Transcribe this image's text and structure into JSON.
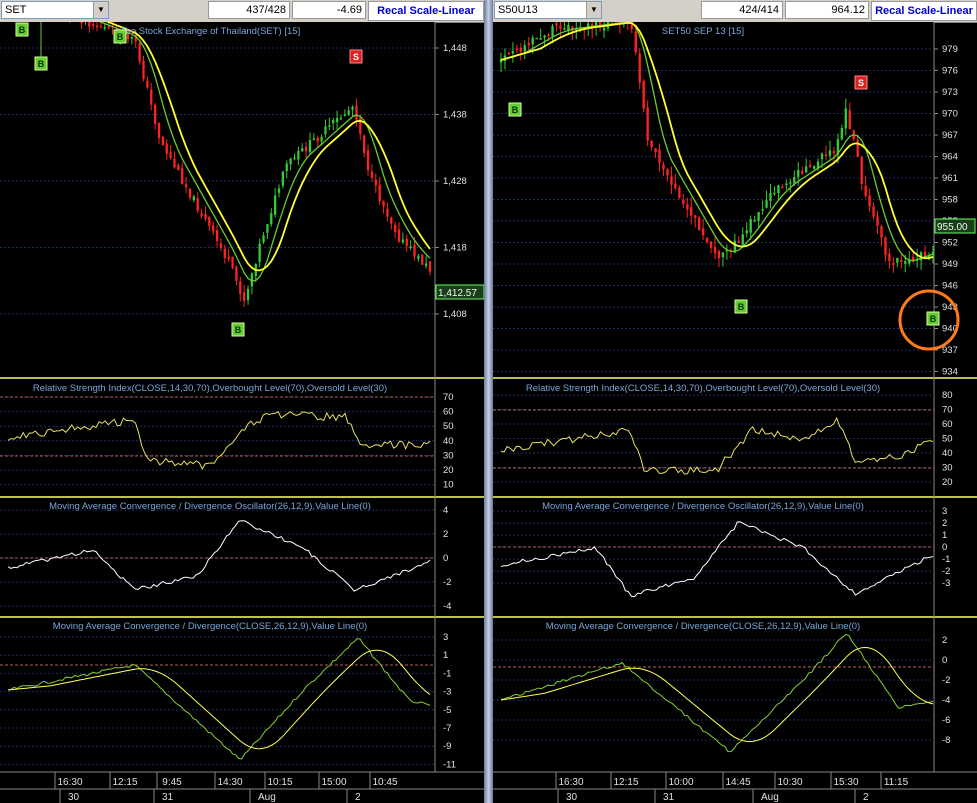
{
  "left": {
    "symbol": "SET",
    "volume": "437/428",
    "change": "-4.69",
    "recal": "Recal Scale-Linear",
    "main_title": "The Stock Exchange of Thailand(SET) [15]",
    "price_ticks": [
      "1,448",
      "1,438",
      "1,428",
      "1,418",
      "1,408"
    ],
    "last_price": "1,412.57",
    "rsi_title": "Relative Strength Index(CLOSE,14,30,70),Overbought Level(70),Oversold Level(30)",
    "rsi_ticks": [
      "70",
      "60",
      "50",
      "40",
      "30",
      "20",
      "10"
    ],
    "osc_title": "Moving Average Convergence / Divergence Oscillator(26,12,9),Value Line(0)",
    "osc_ticks": [
      "4",
      "2",
      "0",
      "-2",
      "-4"
    ],
    "macd_title": "Moving Average Convergence / Divergence(CLOSE,26,12,9),Value Line(0)",
    "macd_ticks": [
      "3",
      "1",
      "-1",
      "-3",
      "-5",
      "-7",
      "-9",
      "-11"
    ],
    "time_labels": [
      "16:30",
      "12:15",
      "9:45",
      "14:30",
      "10:15",
      "15:00",
      "10:45"
    ],
    "date_labels": [
      "30",
      "31",
      "Aug",
      "2"
    ],
    "signals": {
      "buy": "B",
      "sell": "S"
    }
  },
  "right": {
    "symbol": "S50U13",
    "volume": "424/414",
    "change": "964.12",
    "recal": "Recal Scale-Linear",
    "main_title": "SET50 SEP 13  [15]",
    "price_ticks": [
      "979",
      "976",
      "973",
      "970",
      "967",
      "964",
      "961",
      "958",
      "955",
      "952",
      "949",
      "946",
      "943",
      "940",
      "937",
      "934"
    ],
    "last_price": "955.00",
    "rsi_title": "Relative Strength Index(CLOSE,14,30,70),Overbought Level(70),Oversold Level(30)",
    "rsi_ticks": [
      "80",
      "70",
      "60",
      "50",
      "40",
      "30",
      "20"
    ],
    "osc_title": "Moving Average Convergence / Divergence Oscillator(26,12,9),Value Line(0)",
    "osc_ticks": [
      "3",
      "2",
      "1",
      "0",
      "-1",
      "-2",
      "-3"
    ],
    "macd_title": "Moving Average Convergence / Divergence(CLOSE,26,12,9),Value Line(0)",
    "macd_ticks": [
      "2",
      "0",
      "-2",
      "-4",
      "-6",
      "-8"
    ],
    "time_labels": [
      "16:30",
      "12:15",
      "10:00",
      "14:45",
      "10:30",
      "15:30",
      "11:15"
    ],
    "date_labels": [
      "30",
      "31",
      "Aug",
      "2"
    ],
    "signals": {
      "buy": "B",
      "sell": "S"
    }
  },
  "colors": {
    "up": "#33cc33",
    "down": "#ff2222",
    "ma_fast": "#ffff33",
    "ma_slow": "#66cc33",
    "grid": "#1c2d66",
    "panel_border": "#ffff66",
    "axis_text": "#e0e0e0",
    "title_text": "#7aa4d8",
    "level_line": "#b06060",
    "highlight_circle": "#ff7a1a"
  }
}
